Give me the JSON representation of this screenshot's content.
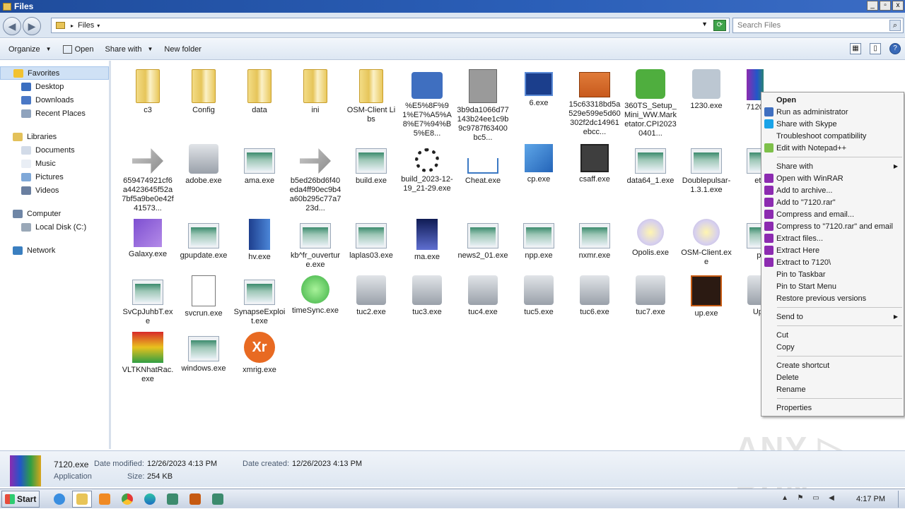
{
  "window": {
    "title": "Files",
    "min": "_",
    "max": "▫",
    "close": "x"
  },
  "address": {
    "crumb": "Files",
    "search_placeholder": "Search Files"
  },
  "toolbar": {
    "organize": "Organize",
    "open": "Open",
    "share_with": "Share with",
    "new_folder": "New folder"
  },
  "nav": {
    "favorites": {
      "label": "Favorites",
      "items": [
        "Desktop",
        "Downloads",
        "Recent Places"
      ]
    },
    "libraries": {
      "label": "Libraries",
      "items": [
        "Documents",
        "Music",
        "Pictures",
        "Videos"
      ]
    },
    "computer": {
      "label": "Computer",
      "items": [
        "Local Disk (C:)"
      ]
    },
    "network": {
      "label": "Network"
    }
  },
  "files": [
    {
      "name": "c3",
      "icon": "folder"
    },
    {
      "name": "Config",
      "icon": "folder"
    },
    {
      "name": "data",
      "icon": "folder"
    },
    {
      "name": "ini",
      "icon": "folder"
    },
    {
      "name": "OSM-Client Libs",
      "icon": "folder"
    },
    {
      "name": "%E5%8F%91%E7%A5%A8%E7%94%B5%E8...",
      "icon": "shield"
    },
    {
      "name": "3b9da1066d77143b24ee1c9b9c9787f63400bc5...",
      "icon": "blank"
    },
    {
      "name": "6.exe",
      "icon": "term"
    },
    {
      "name": "15c63318bd5a529e599e5d60302f2dc14961ebcc...",
      "icon": "box"
    },
    {
      "name": "360TS_Setup_Mini_WW.Marketator.CPI20230401...",
      "icon": "greenapp"
    },
    {
      "name": "1230.exe",
      "icon": "disc"
    },
    {
      "name": "7120.exe",
      "icon": "rar"
    },
    {
      "name": "",
      "icon": "rar"
    },
    {
      "name": "",
      "icon": "circle"
    },
    {
      "name": "659474921cf6a4423645f52a7bf5a9be0e42f41573...",
      "icon": "arrow"
    },
    {
      "name": "adobe.exe",
      "icon": "music"
    },
    {
      "name": "ama.exe",
      "icon": "app"
    },
    {
      "name": "b5ed26bd6f40eda4ff90ec9b4a60b295c77a723d...",
      "icon": "arrow"
    },
    {
      "name": "build.exe",
      "icon": "app"
    },
    {
      "name": "build_2023-12-19_21-29.exe",
      "icon": "spinner"
    },
    {
      "name": "Cheat.exe",
      "icon": "download"
    },
    {
      "name": "cp.exe",
      "icon": "cube"
    },
    {
      "name": "csaff.exe",
      "icon": "gift"
    },
    {
      "name": "data64_1.exe",
      "icon": "app"
    },
    {
      "name": "Doublepulsar-1.3.1.exe",
      "icon": "app"
    },
    {
      "name": "etop",
      "icon": "app"
    },
    {
      "name": "Galaxy.exe",
      "icon": "vs"
    },
    {
      "name": "gpupdate.exe",
      "icon": "app"
    },
    {
      "name": "hv.exe",
      "icon": "book"
    },
    {
      "name": "kb^fr_ouverture.exe",
      "icon": "app"
    },
    {
      "name": "laplas03.exe",
      "icon": "app"
    },
    {
      "name": "ma.exe",
      "icon": "blackapp"
    },
    {
      "name": "news2_01.exe",
      "icon": "app"
    },
    {
      "name": "npp.exe",
      "icon": "app"
    },
    {
      "name": "nxmr.exe",
      "icon": "app"
    },
    {
      "name": "Opolis.exe",
      "icon": "warn"
    },
    {
      "name": "OSM-Client.exe",
      "icon": "warn"
    },
    {
      "name": "pdf",
      "icon": "app"
    },
    {
      "name": "SvCpJuhbT.exe",
      "icon": "app"
    },
    {
      "name": "svcrun.exe",
      "icon": "page"
    },
    {
      "name": "SynapseExploit.exe",
      "icon": "app"
    },
    {
      "name": "timeSync.exe",
      "icon": "circle"
    },
    {
      "name": "tuc2.exe",
      "icon": "music"
    },
    {
      "name": "tuc3.exe",
      "icon": "music"
    },
    {
      "name": "tuc4.exe",
      "icon": "music"
    },
    {
      "name": "tuc5.exe",
      "icon": "music"
    },
    {
      "name": "tuc6.exe",
      "icon": "music"
    },
    {
      "name": "tuc7.exe",
      "icon": "music"
    },
    {
      "name": "up.exe",
      "icon": "up"
    },
    {
      "name": "Upda",
      "icon": "music"
    },
    {
      "name": "VLTKNhatRac.exe",
      "icon": "game"
    },
    {
      "name": "windows.exe",
      "icon": "app"
    },
    {
      "name": "xmrig.exe",
      "icon": "xmrig"
    }
  ],
  "context_menu": [
    {
      "label": "Open",
      "bold": true
    },
    {
      "label": "Run as administrator",
      "icon": "shield-icon"
    },
    {
      "label": "Share with Skype",
      "icon": "skype-icon"
    },
    {
      "label": "Troubleshoot compatibility"
    },
    {
      "label": "Edit with Notepad++",
      "icon": "notepadpp-icon"
    },
    {
      "sep": true
    },
    {
      "label": "Share with",
      "submenu": true
    },
    {
      "label": "Open with WinRAR",
      "icon": "winrar-icon"
    },
    {
      "label": "Add to archive...",
      "icon": "winrar-icon"
    },
    {
      "label": "Add to \"7120.rar\"",
      "icon": "winrar-icon"
    },
    {
      "label": "Compress and email...",
      "icon": "winrar-icon"
    },
    {
      "label": "Compress to \"7120.rar\" and email",
      "icon": "winrar-icon"
    },
    {
      "label": "Extract files...",
      "icon": "winrar-icon"
    },
    {
      "label": "Extract Here",
      "icon": "winrar-icon"
    },
    {
      "label": "Extract to 7120\\",
      "icon": "winrar-icon"
    },
    {
      "label": "Pin to Taskbar"
    },
    {
      "label": "Pin to Start Menu"
    },
    {
      "label": "Restore previous versions"
    },
    {
      "sep": true
    },
    {
      "label": "Send to",
      "submenu": true
    },
    {
      "sep": true
    },
    {
      "label": "Cut"
    },
    {
      "label": "Copy"
    },
    {
      "sep": true
    },
    {
      "label": "Create shortcut"
    },
    {
      "label": "Delete"
    },
    {
      "label": "Rename"
    },
    {
      "sep": true
    },
    {
      "label": "Properties"
    }
  ],
  "details": {
    "name": "7120.exe",
    "type": "Application",
    "modified_label": "Date modified:",
    "modified": "12/26/2023 4:13 PM",
    "created_label": "Date created:",
    "created": "12/26/2023 4:13 PM",
    "size_label": "Size:",
    "size": "254 KB"
  },
  "taskbar": {
    "start": "Start",
    "clock": "4:17 PM"
  },
  "watermark": "ANY ▷ RUN"
}
